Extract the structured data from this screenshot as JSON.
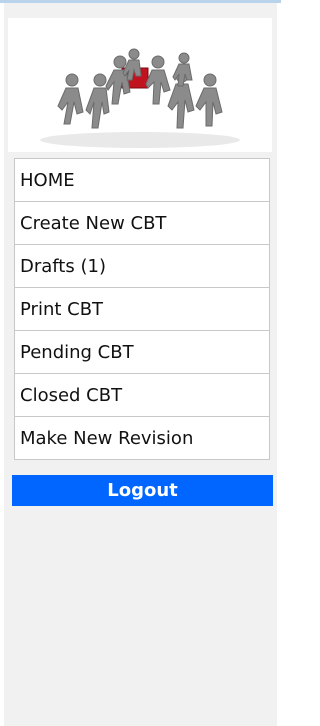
{
  "menu": {
    "items": [
      {
        "label": "HOME"
      },
      {
        "label": "Create New CBT"
      },
      {
        "label": "Drafts (1)"
      },
      {
        "label": "Print CBT"
      },
      {
        "label": "Pending CBT"
      },
      {
        "label": "Closed CBT"
      },
      {
        "label": "Make New Revision"
      }
    ]
  },
  "logout": {
    "label": "Logout"
  },
  "colors": {
    "logout_bg": "#0066ff",
    "sidebar_bg": "#f1f1f1",
    "accent_red": "#c1121f"
  },
  "hero": {
    "icon": "team-people-icon"
  }
}
